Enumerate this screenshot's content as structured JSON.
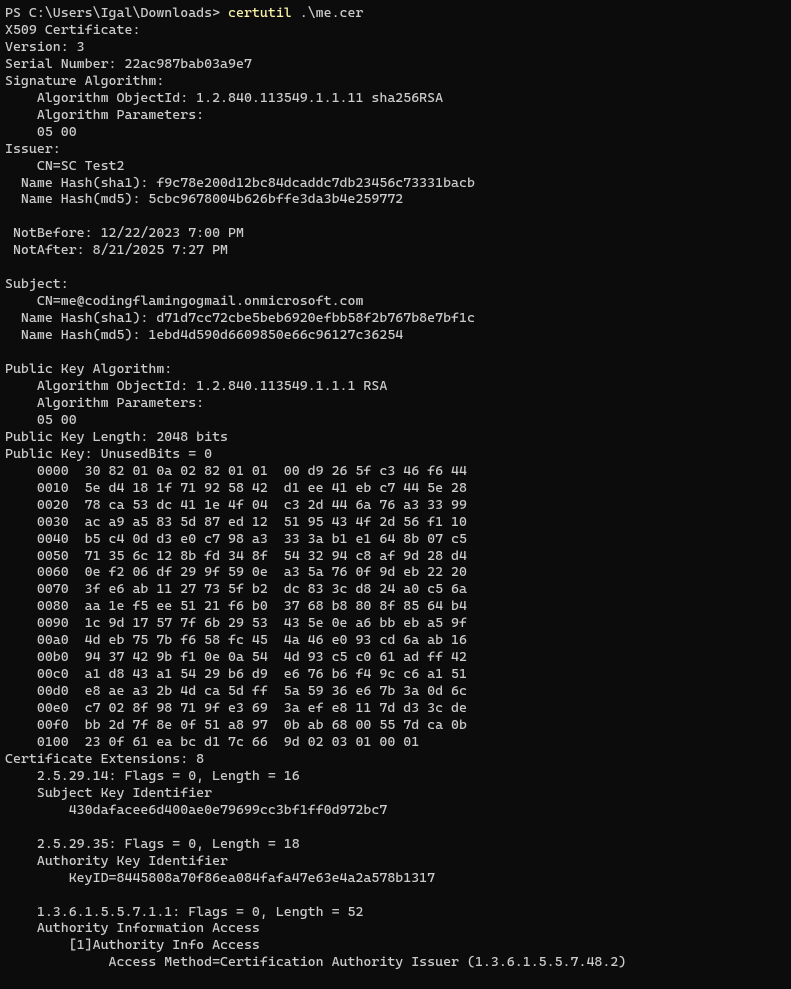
{
  "prompt": "PS C:\\Users\\Igal\\Downloads>",
  "command": "certutil",
  "argument": ".\\me.cer",
  "output": [
    "X509 Certificate:",
    "Version: 3",
    "Serial Number: 22ac987bab03a9e7",
    "Signature Algorithm:",
    "    Algorithm ObjectId: 1.2.840.113549.1.1.11 sha256RSA",
    "    Algorithm Parameters:",
    "    05 00",
    "Issuer:",
    "    CN=SC Test2",
    "  Name Hash(sha1): f9c78e200d12bc84dcaddc7db23456c73331bacb",
    "  Name Hash(md5): 5cbc9678004b626bffe3da3b4e259772",
    "",
    " NotBefore: 12/22/2023 7:00 PM",
    " NotAfter: 8/21/2025 7:27 PM",
    "",
    "Subject:",
    "    CN=me@codingflamingogmail.onmicrosoft.com",
    "  Name Hash(sha1): d71d7cc72cbe5beb6920efbb58f2b767b8e7bf1c",
    "  Name Hash(md5): 1ebd4d590d6609850e66c96127c36254",
    "",
    "Public Key Algorithm:",
    "    Algorithm ObjectId: 1.2.840.113549.1.1.1 RSA",
    "    Algorithm Parameters:",
    "    05 00",
    "Public Key Length: 2048 bits",
    "Public Key: UnusedBits = 0",
    "    0000  30 82 01 0a 02 82 01 01  00 d9 26 5f c3 46 f6 44",
    "    0010  5e d4 18 1f 71 92 58 42  d1 ee 41 eb c7 44 5e 28",
    "    0020  78 ca 53 dc 41 1e 4f 04  c3 2d 44 6a 76 a3 33 99",
    "    0030  ac a9 a5 83 5d 87 ed 12  51 95 43 4f 2d 56 f1 10",
    "    0040  b5 c4 0d d3 e0 c7 98 a3  33 3a b1 e1 64 8b 07 c5",
    "    0050  71 35 6c 12 8b fd 34 8f  54 32 94 c8 af 9d 28 d4",
    "    0060  0e f2 06 df 29 9f 59 0e  a3 5a 76 0f 9d eb 22 20",
    "    0070  3f e6 ab 11 27 73 5f b2  dc 83 3c d8 24 a0 c5 6a",
    "    0080  aa 1e f5 ee 51 21 f6 b0  37 68 b8 80 8f 85 64 b4",
    "    0090  1c 9d 17 57 7f 6b 29 53  43 5e 0e a6 bb eb a5 9f",
    "    00a0  4d eb 75 7b f6 58 fc 45  4a 46 e0 93 cd 6a ab 16",
    "    00b0  94 37 42 9b f1 0e 0a 54  4d 93 c5 c0 61 ad ff 42",
    "    00c0  a1 d8 43 a1 54 29 b6 d9  e6 76 b6 f4 9c c6 a1 51",
    "    00d0  e8 ae a3 2b 4d ca 5d ff  5a 59 36 e6 7b 3a 0d 6c",
    "    00e0  c7 02 8f 98 71 9f e3 69  3a ef e8 11 7d d3 3c de",
    "    00f0  bb 2d 7f 8e 0f 51 a8 97  0b ab 68 00 55 7d ca 0b",
    "    0100  23 0f 61 ea bc d1 7c 66  9d 02 03 01 00 01",
    "Certificate Extensions: 8",
    "    2.5.29.14: Flags = 0, Length = 16",
    "    Subject Key Identifier",
    "        430dafacee6d400ae0e79699cc3bf1ff0d972bc7",
    "",
    "    2.5.29.35: Flags = 0, Length = 18",
    "    Authority Key Identifier",
    "        KeyID=8445808a70f86ea084fafa47e63e4a2a578b1317",
    "",
    "    1.3.6.1.5.5.7.1.1: Flags = 0, Length = 52",
    "    Authority Information Access",
    "        [1]Authority Info Access",
    "             Access Method=Certification Authority Issuer (1.3.6.1.5.5.7.48.2)"
  ]
}
